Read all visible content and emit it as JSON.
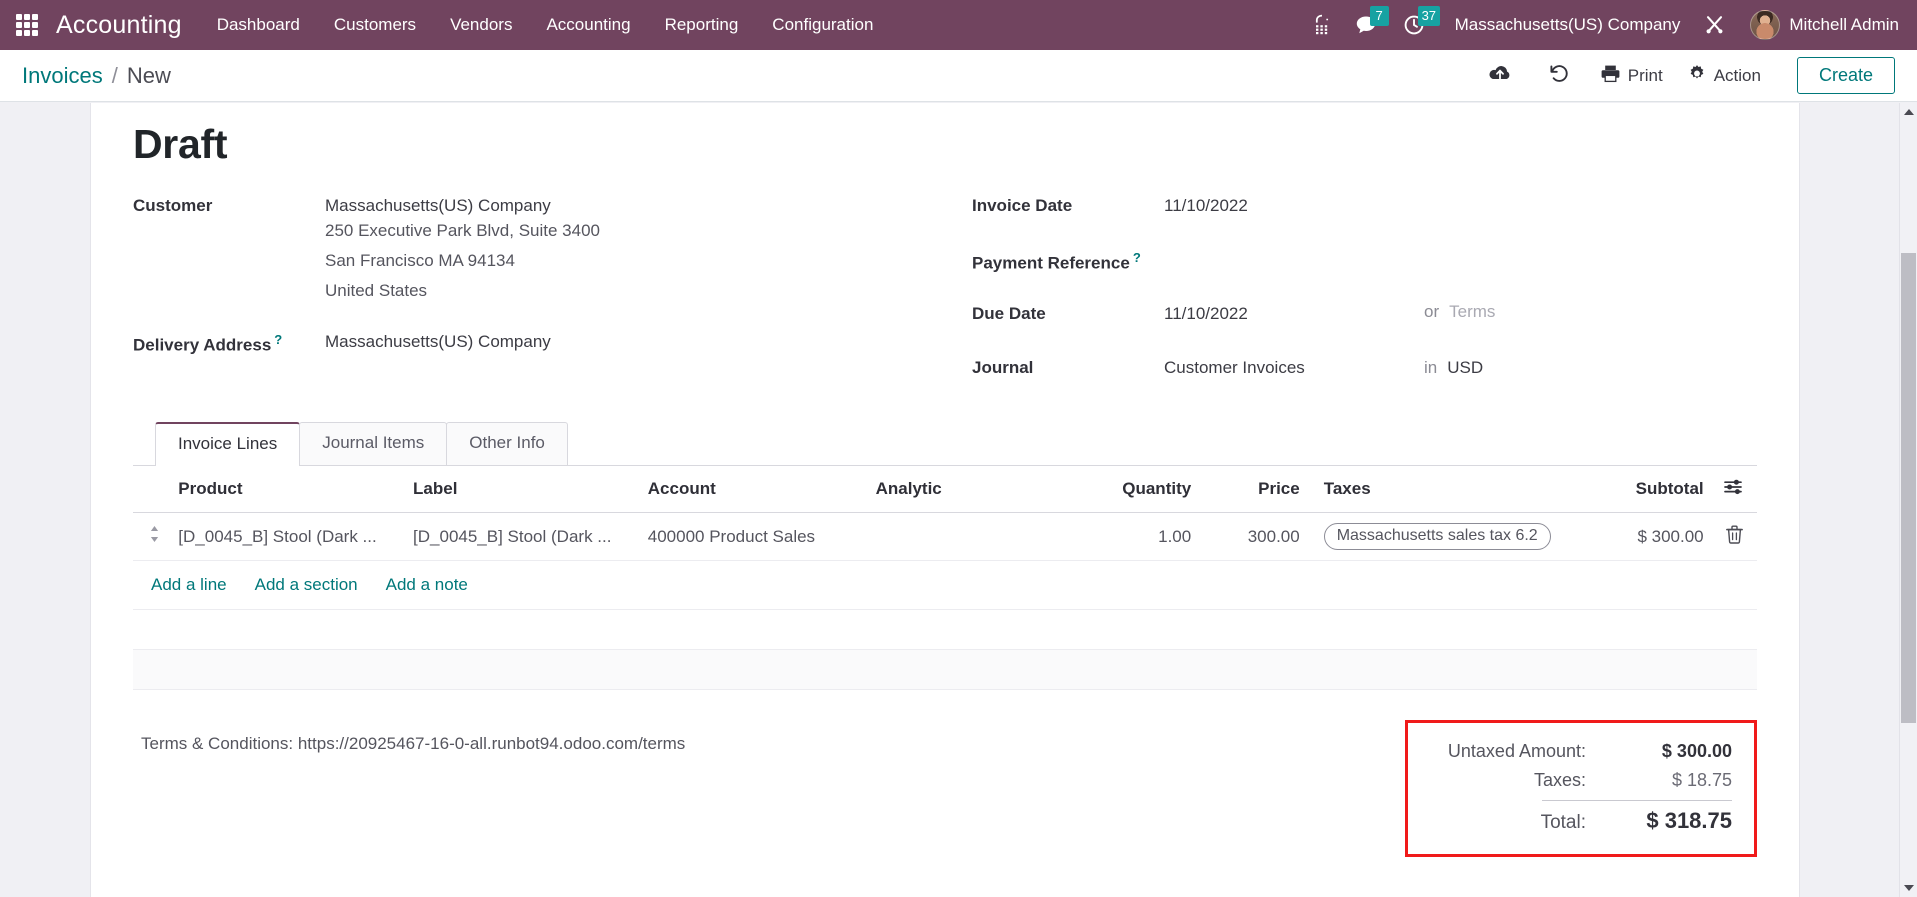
{
  "navbar": {
    "apps_icon": "apps-grid-icon",
    "brand": "Accounting",
    "menu": [
      {
        "label": "Dashboard"
      },
      {
        "label": "Customers"
      },
      {
        "label": "Vendors"
      },
      {
        "label": "Accounting"
      },
      {
        "label": "Reporting"
      },
      {
        "label": "Configuration"
      }
    ],
    "phone_icon": "voip-phone-icon",
    "messages": {
      "icon": "chat-bubble-icon",
      "count": "7"
    },
    "activities": {
      "icon": "clock-icon",
      "count": "37"
    },
    "company": "Massachusetts(US) Company",
    "debug_icon": "developer-tools-icon",
    "user": "Mitchell Admin",
    "accent": "#71445f",
    "badge_color": "#17a2a2"
  },
  "controlpanel": {
    "breadcrumb_root": "Invoices",
    "breadcrumb_sep": "/",
    "breadcrumb_current": "New",
    "save_icon": "cloud-upload-icon",
    "discard_icon": "undo-icon",
    "print_label": "Print",
    "print_icon": "printer-icon",
    "action_label": "Action",
    "action_icon": "gear-icon",
    "create_label": "Create",
    "accent": "#00787a"
  },
  "form": {
    "status_title": "Draft",
    "left_fields": [
      {
        "label": "Customer",
        "value": "Massachusetts(US) Company",
        "help": false
      },
      {
        "label": "Delivery Address",
        "value": "Massachusetts(US) Company",
        "help": true
      }
    ],
    "customer_address": [
      "250 Executive Park Blvd, Suite 3400",
      "San Francisco MA 94134",
      "United States"
    ],
    "right_fields": [
      {
        "label": "Invoice Date",
        "value": "11/10/2022",
        "help": false,
        "tail_word": "",
        "tail_value": ""
      },
      {
        "label": "Payment Reference",
        "value": "",
        "help": true,
        "tail_word": "",
        "tail_value": ""
      },
      {
        "label": "Due Date",
        "value": "11/10/2022",
        "help": false,
        "tail_word": "or",
        "tail_value": "Terms",
        "tail_placeholder": true
      },
      {
        "label": "Journal",
        "value": "Customer Invoices",
        "help": false,
        "tail_word": "in",
        "tail_value": "USD",
        "tail_placeholder": false
      }
    ]
  },
  "notebook": {
    "tabs": [
      {
        "label": "Invoice Lines",
        "active": true
      },
      {
        "label": "Journal Items",
        "active": false
      },
      {
        "label": "Other Info",
        "active": false
      }
    ]
  },
  "lines": {
    "columns": [
      "Product",
      "Label",
      "Account",
      "Analytic",
      "Quantity",
      "Price",
      "Taxes",
      "Subtotal"
    ],
    "optional_columns_icon": "column-settings-icon",
    "rows": [
      {
        "handle_icon": "drag-handle-icon",
        "product": "[D_0045_B] Stool (Dark ...",
        "label": "[D_0045_B] Stool (Dark ...",
        "account": "400000 Product Sales",
        "analytic": "",
        "quantity": "1.00",
        "price": "300.00",
        "taxes": "Massachusetts sales tax 6.2",
        "subtotal": "$ 300.00",
        "delete_icon": "trash-icon"
      }
    ],
    "add_line": "Add a line",
    "add_section": "Add a section",
    "add_note": "Add a note"
  },
  "footer": {
    "terms": "Terms & Conditions: https://20925467-16-0-all.runbot94.odoo.com/terms",
    "totals": {
      "untaxed_label": "Untaxed Amount:",
      "untaxed_value": "$ 300.00",
      "taxes_label": "Taxes:",
      "taxes_value": "$ 18.75",
      "total_label": "Total:",
      "total_value": "$ 318.75",
      "highlight_color": "#f01a1a"
    }
  }
}
